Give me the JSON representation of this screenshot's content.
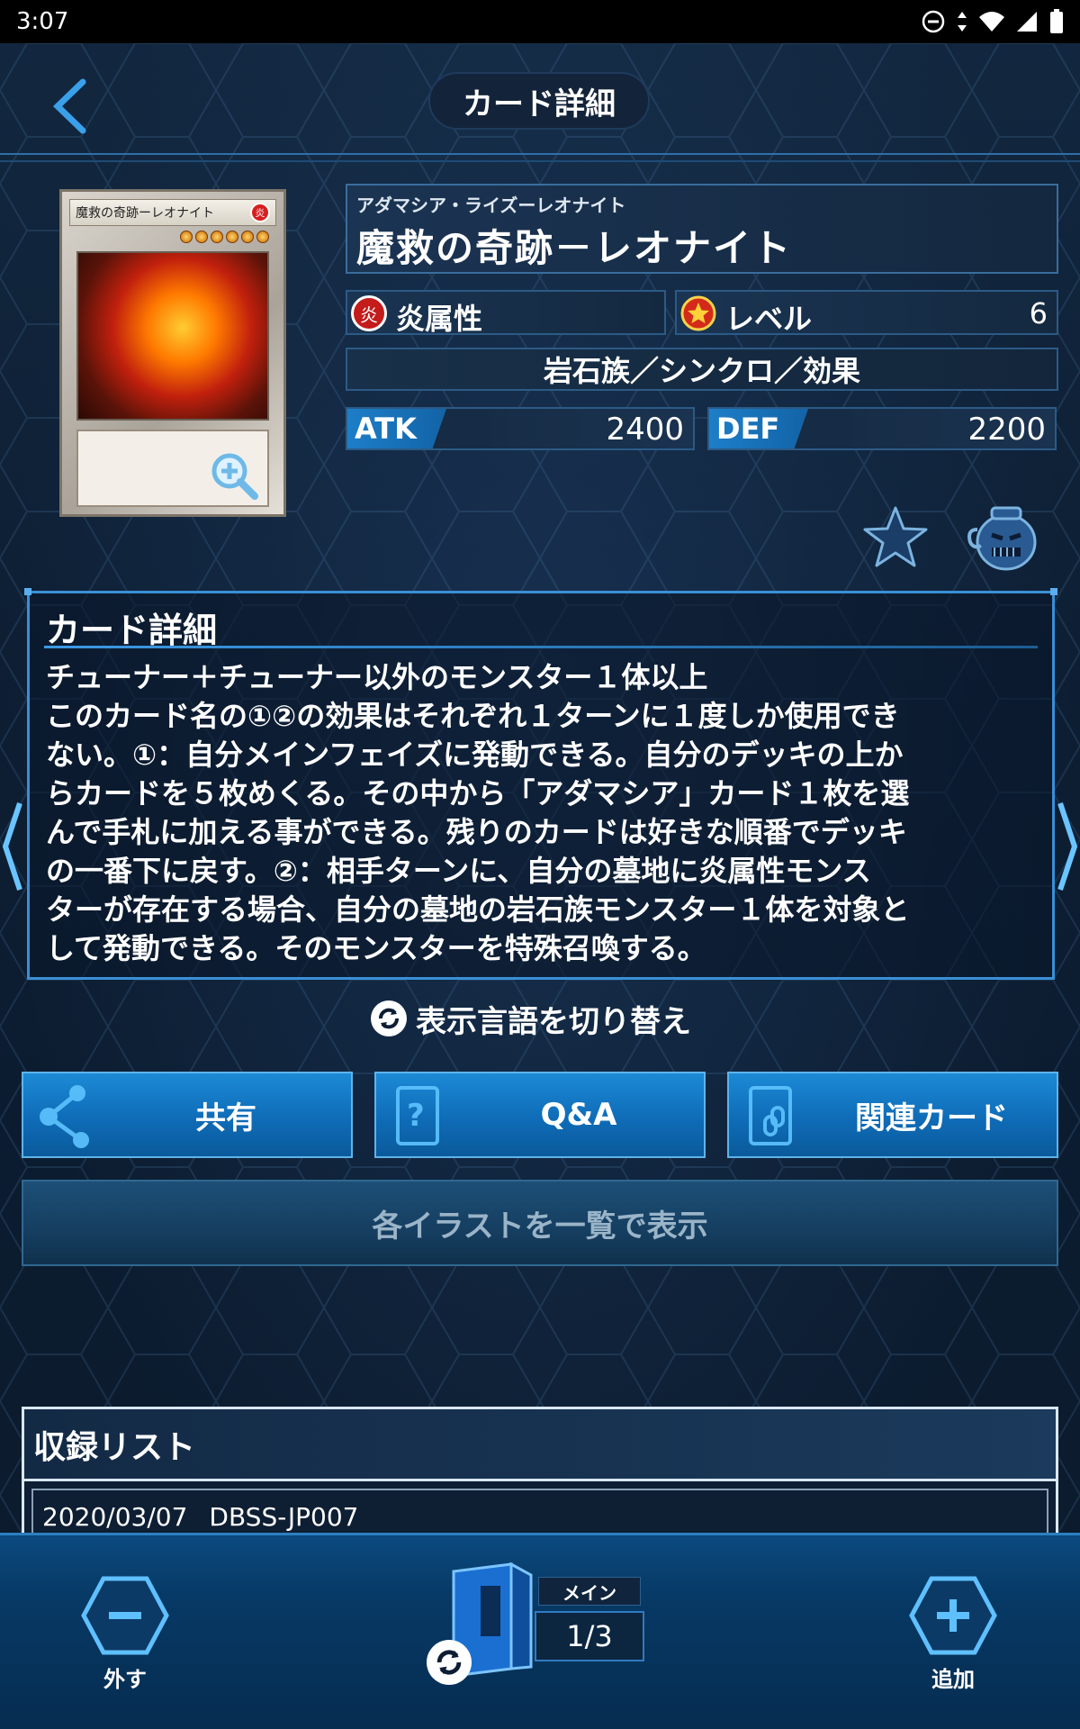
{
  "status_bar": {
    "time": "3:07"
  },
  "header": {
    "title": "カード詳細"
  },
  "card": {
    "thumb_name": "魔救の奇跡ーレオナイト",
    "thumb_attribute": "炎",
    "ruby": "アダマシア・ライズーレオナイト",
    "name": "魔救の奇跡－レオナイト",
    "attribute_label": "炎属性",
    "attribute_icon": "炎",
    "level_label": "レベル",
    "level_value": "6",
    "type_line": "岩石族／シンクロ／効果",
    "atk_label": "ATK",
    "atk_value": "2400",
    "def_label": "DEF",
    "def_value": "2200"
  },
  "detail": {
    "title": "カード詳細",
    "text": "チューナー＋チューナー以外のモンスター１体以上\nこのカード名の①②の効果はそれぞれ１ターンに１度しか使用でき\nない。①：自分メインフェイズに発動できる。自分のデッキの上か\nらカードを５枚めくる。その中から「アダマシア」カード１枚を選\nんで手札に加える事ができる。残りのカードは好きな順番でデッキ\nの一番下に戻す。②：相手ターンに、自分の墓地に炎属性モンス\nターが存在する場合、自分の墓地の岩石族モンスター１体を対象と\nして発動できる。そのモンスターを特殊召喚する。"
  },
  "lang_toggle": "表示言語を切り替え",
  "buttons": {
    "share": "共有",
    "qa": "Q&A",
    "related": "関連カード",
    "illust": "各イラストを一覧で表示"
  },
  "list": {
    "title": "収録リスト",
    "rows": [
      {
        "date": "2020/03/07",
        "code": "DBSS-JP007"
      }
    ]
  },
  "bottom": {
    "remove": "外す",
    "add": "追加",
    "deck_label": "メイン",
    "deck_count": "1/3"
  }
}
